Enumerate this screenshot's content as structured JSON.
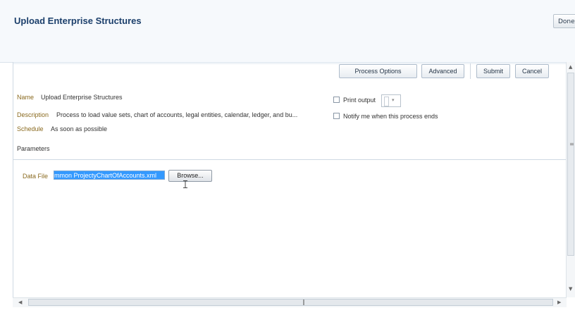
{
  "header": {
    "title": "Upload Enterprise Structures",
    "done_label": "Done"
  },
  "toolbar": {
    "process_options_label": "Process Options",
    "advanced_label": "Advanced",
    "submit_label": "Submit",
    "cancel_label": "Cancel"
  },
  "details": {
    "name_label": "Name",
    "name_value": "Upload Enterprise Structures",
    "description_label": "Description",
    "description_value": "Process to load value sets, chart of accounts, legal entities, calendar, ledger, and bu...",
    "schedule_label": "Schedule",
    "schedule_value": "As soon as possible"
  },
  "options": {
    "print_output_label": "Print output",
    "print_output_checked": false,
    "notify_label": "Notify me when this process ends",
    "notify_checked": false
  },
  "parameters": {
    "section_title": "Parameters",
    "data_file_label": "Data File",
    "data_file_value": "mmon ProjectyChartOfAccounts.xml",
    "browse_label": "Browse..."
  },
  "colors": {
    "title": "#1b3f6b",
    "label": "#8a6a1f",
    "selection": "#3399ff"
  }
}
